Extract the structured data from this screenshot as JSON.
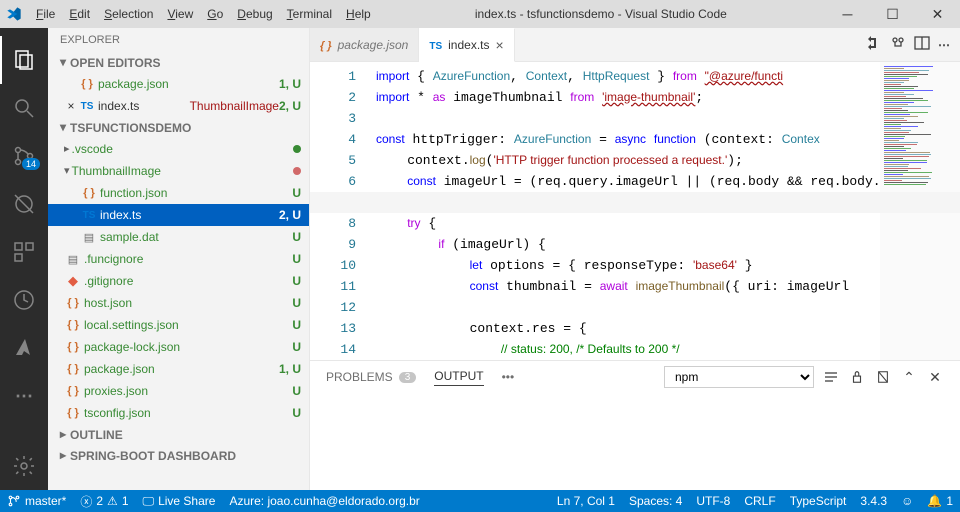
{
  "title": "index.ts - tsfunctionsdemo - Visual Studio Code",
  "menu": [
    "File",
    "Edit",
    "Selection",
    "View",
    "Go",
    "Debug",
    "Terminal",
    "Help"
  ],
  "activity": {
    "badge": "14"
  },
  "sidebar": {
    "title": "EXPLORER",
    "openEditors": {
      "label": "OPEN EDITORS",
      "items": [
        {
          "icon": "json",
          "name": "package.json",
          "status": "1, U"
        },
        {
          "icon": "ts",
          "name": "index.ts",
          "desc": "ThumbnailImage",
          "status": "2, U",
          "active": true
        }
      ]
    },
    "folder": {
      "label": "TSFUNCTIONSDEMO",
      "items": [
        {
          "t": "folder",
          "chev": "▸",
          "name": ".vscode",
          "dot": "green",
          "ind": 1
        },
        {
          "t": "folder",
          "chev": "▾",
          "name": "ThumbnailImage",
          "dot": "red",
          "ind": 1
        },
        {
          "t": "file",
          "icon": "json",
          "name": "function.json",
          "status": "U",
          "ind": 2
        },
        {
          "t": "file",
          "icon": "ts",
          "name": "index.ts",
          "status": "2, U",
          "ind": 2,
          "sel": true
        },
        {
          "t": "file",
          "icon": "dat",
          "name": "sample.dat",
          "status": "U",
          "ind": 2
        },
        {
          "t": "file",
          "icon": "dat",
          "name": ".funcignore",
          "status": "U",
          "ind": 1
        },
        {
          "t": "file",
          "icon": "git",
          "name": ".gitignore",
          "status": "U",
          "ind": 1
        },
        {
          "t": "file",
          "icon": "json",
          "name": "host.json",
          "status": "U",
          "ind": 1
        },
        {
          "t": "file",
          "icon": "json",
          "name": "local.settings.json",
          "status": "U",
          "ind": 1
        },
        {
          "t": "file",
          "icon": "json",
          "name": "package-lock.json",
          "status": "U",
          "ind": 1
        },
        {
          "t": "file",
          "icon": "json",
          "name": "package.json",
          "status": "1, U",
          "ind": 1
        },
        {
          "t": "file",
          "icon": "json",
          "name": "proxies.json",
          "status": "U",
          "ind": 1
        },
        {
          "t": "file",
          "icon": "json",
          "name": "tsconfig.json",
          "status": "U",
          "ind": 1
        }
      ]
    },
    "outline": "OUTLINE",
    "springBoot": "SPRING-BOOT DASHBOARD"
  },
  "tabs": [
    {
      "icon": "json",
      "label": "package.json",
      "active": false
    },
    {
      "icon": "ts",
      "label": "index.ts",
      "active": true,
      "close": true
    }
  ],
  "code": {
    "lines": [
      [
        [
          "kw",
          "import"
        ],
        [
          "",
          " { "
        ],
        [
          "ty",
          "AzureFunction"
        ],
        [
          "",
          ", "
        ],
        [
          "ty",
          "Context"
        ],
        [
          "",
          ", "
        ],
        [
          "ty",
          "HttpRequest"
        ],
        [
          "",
          " } "
        ],
        [
          "ctl",
          "from"
        ],
        [
          "",
          " "
        ],
        [
          "strU",
          "\"@azure/functi"
        ]
      ],
      [
        [
          "kw",
          "import"
        ],
        [
          "",
          " * "
        ],
        [
          "ctl",
          "as"
        ],
        [
          "",
          " imageThumbnail "
        ],
        [
          "ctl",
          "from"
        ],
        [
          "",
          " "
        ],
        [
          "strU",
          "'image-thumbnail'"
        ],
        [
          "",
          ";"
        ]
      ],
      [
        [
          "",
          ""
        ]
      ],
      [
        [
          "kw",
          "const"
        ],
        [
          "",
          " httpTrigger: "
        ],
        [
          "ty",
          "AzureFunction"
        ],
        [
          "",
          " = "
        ],
        [
          "kw",
          "async"
        ],
        [
          "",
          " "
        ],
        [
          "kw",
          "function"
        ],
        [
          "",
          " (context: "
        ],
        [
          "ty",
          "Contex"
        ]
      ],
      [
        [
          "",
          "    context."
        ],
        [
          "fn",
          "log"
        ],
        [
          "",
          "("
        ],
        [
          "str",
          "'HTTP trigger function processed a request.'"
        ],
        [
          "",
          ");"
        ]
      ],
      [
        [
          "",
          "    "
        ],
        [
          "kw",
          "const"
        ],
        [
          "",
          " imageUrl = (req.query.imageUrl || (req.body && req.body."
        ]
      ],
      [
        [
          "",
          ""
        ]
      ],
      [
        [
          "",
          "    "
        ],
        [
          "ctl",
          "try"
        ],
        [
          "",
          " {"
        ]
      ],
      [
        [
          "",
          "        "
        ],
        [
          "ctl",
          "if"
        ],
        [
          "",
          " (imageUrl) {"
        ]
      ],
      [
        [
          "",
          "            "
        ],
        [
          "kw",
          "let"
        ],
        [
          "",
          " options = { responseType: "
        ],
        [
          "str",
          "'base64'"
        ],
        [
          "",
          " }"
        ]
      ],
      [
        [
          "",
          "            "
        ],
        [
          "kw",
          "const"
        ],
        [
          "",
          " thumbnail = "
        ],
        [
          "ctl",
          "await"
        ],
        [
          "",
          " "
        ],
        [
          "fn",
          "imageThumbnail"
        ],
        [
          "",
          "({ uri: imageUrl"
        ]
      ],
      [
        [
          "",
          ""
        ]
      ],
      [
        [
          "",
          "            context.res = {"
        ]
      ],
      [
        [
          "",
          "                "
        ],
        [
          "com",
          "// status: 200, /* Defaults to 200 */"
        ]
      ]
    ],
    "cursorLine": 7
  },
  "panel": {
    "problems": "PROBLEMS",
    "problemsCount": "3",
    "output": "OUTPUT",
    "more": "•••",
    "select": "npm"
  },
  "status": {
    "branch": "master*",
    "errors": "2",
    "warnings": "1",
    "liveShare": "Live Share",
    "azure": "Azure: joao.cunha@eldorado.org.br",
    "lnCol": "Ln 7, Col 1",
    "spaces": "Spaces: 4",
    "encoding": "UTF-8",
    "eol": "CRLF",
    "lang": "TypeScript",
    "ver": "3.4.3",
    "bell": "1"
  }
}
